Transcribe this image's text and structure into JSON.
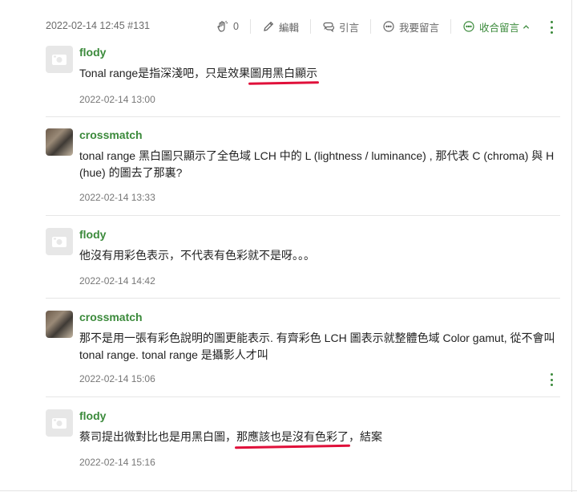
{
  "post": {
    "meta": "2022-02-14 12:45 #131",
    "like_count": "0",
    "edit_label": "編輯",
    "quote_label": "引言",
    "reply_label": "我要留言",
    "collapse_label": "收合留言",
    "collapse_chevron": "chevron-up-icon",
    "more_icon": "vertical-ellipsis-icon"
  },
  "colors": {
    "accent_green": "#3b8a3b",
    "highlight_red": "#e0103a"
  },
  "comments": [
    {
      "author": "flody",
      "avatar": "default-avatar-icon",
      "text": "Tonal range是指深淺吧，只是效果圖用黑白顯示",
      "text_pre": "Tonal range是指深淺吧，只是效果",
      "text_mark": "圖用黑白顯示",
      "text_post": "",
      "time": "2022-02-14 13:00"
    },
    {
      "author": "crossmatch",
      "avatar": "photo-avatar",
      "text": "tonal range 黑白圖只顯示了全色域 LCH 中的 L (lightness / luminance) , 那代表 C (chroma) 與 H (hue) 的圖去了那裏?",
      "time": "2022-02-14 13:33"
    },
    {
      "author": "flody",
      "avatar": "default-avatar-icon",
      "text": "他沒有用彩色表示，不代表有色彩就不是呀。。。",
      "time": "2022-02-14 14:42"
    },
    {
      "author": "crossmatch",
      "avatar": "photo-avatar",
      "text": "那不是用一張有彩色說明的圖更能表示. 有齊彩色 LCH 圖表示就整體色域 Color gamut, 從不會叫 tonal range. tonal range 是攝影人才叫",
      "time": "2022-02-14 15:06"
    },
    {
      "author": "flody",
      "avatar": "default-avatar-icon",
      "text": "蔡司提出微對比也是用黑白圖，那應該也是沒有色彩了，結案",
      "text_pre": "蔡司提出微對比也是用黑白圖，",
      "text_mark": "那應該也是沒有色彩了",
      "text_post": "，結案",
      "time": "2022-02-14 15:16"
    }
  ]
}
